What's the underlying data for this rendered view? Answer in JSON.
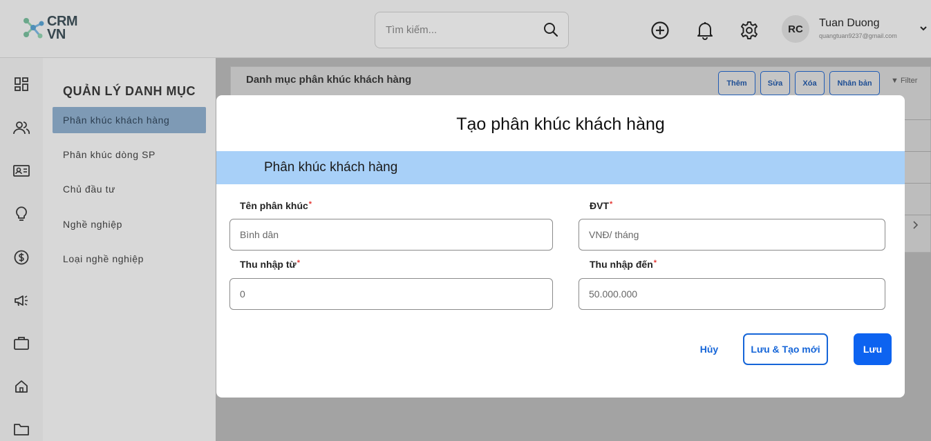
{
  "app": {
    "logo_line1": "CRM",
    "logo_line2": "VN"
  },
  "header": {
    "search_placeholder": "Tìm kiếm...",
    "user_initials": "RC",
    "user_name": "Tuan Duong",
    "user_email": "quangtuan9237@gmail.com",
    "icons": [
      "add-circle-icon",
      "bell-icon",
      "gear-icon"
    ]
  },
  "rail": {
    "icons": [
      "dashboard-icon",
      "users-icon",
      "contact-card-icon",
      "lightbulb-icon",
      "dollar-icon",
      "megaphone-icon",
      "briefcase-icon",
      "home-icon",
      "folder-icon"
    ]
  },
  "sidebar": {
    "title": "QUẢN LÝ DANH MỤC",
    "items": [
      {
        "label": "Phân khúc khách hàng",
        "active": true
      },
      {
        "label": "Phân khúc dòng SP",
        "active": false
      },
      {
        "label": "Chủ đầu tư",
        "active": false
      },
      {
        "label": "Nghề nghiệp",
        "active": false
      },
      {
        "label": "Loại nghề nghiệp",
        "active": false
      }
    ]
  },
  "background_page": {
    "title": "Danh mục phân khúc khách hàng",
    "buttons": [
      "Thêm",
      "Sửa",
      "Xóa",
      "Nhân bản"
    ],
    "filter_label": "Filter"
  },
  "modal": {
    "title": "Tạo phân khúc khách hàng",
    "section_label": "Phân khúc khách hàng",
    "required_mark": "*",
    "fields": {
      "segment_name": {
        "label": "Tên phân khúc",
        "placeholder": "Bình dân"
      },
      "unit": {
        "label": "ĐVT",
        "placeholder": "VNĐ/ tháng"
      },
      "income_from": {
        "label": "Thu nhập từ",
        "placeholder": "0"
      },
      "income_to": {
        "label": "Thu nhập đến",
        "placeholder": "50.000.000"
      }
    },
    "buttons": {
      "cancel": "Hủy",
      "save_and_new": "Lưu & Tạo mới",
      "save": "Lưu"
    }
  },
  "colors": {
    "primary": "#0d63f0",
    "section_band": "#a8d0f8",
    "sidebar_active": "#7e9ab5",
    "required": "#e53935"
  }
}
